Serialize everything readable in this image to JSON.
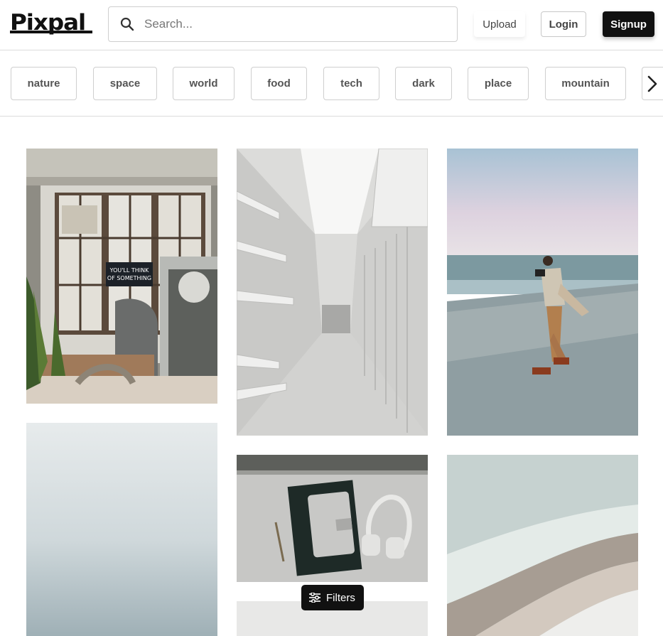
{
  "brand": {
    "logo_text": "Pixpal"
  },
  "search": {
    "placeholder": "Search...",
    "value": "",
    "icon": "search-icon"
  },
  "nav": {
    "upload_label": "Upload",
    "login_label": "Login",
    "signup_label": "Signup"
  },
  "categories": {
    "items": [
      "nature",
      "space",
      "world",
      "food",
      "tech",
      "dark",
      "place",
      "mountain"
    ],
    "next_icon": "chevron-right-icon"
  },
  "photos": [
    {
      "subject": "office-window"
    },
    {
      "subject": "white-corridor"
    },
    {
      "subject": "beach-photographer"
    },
    {
      "subject": "foggy-sea"
    },
    {
      "subject": "notebook-headphones"
    },
    {
      "subject": "abstract-waves"
    },
    {
      "subject": "partial-photo"
    }
  ],
  "filters": {
    "label": "Filters",
    "icon": "sliders-icon"
  },
  "colors": {
    "brand": "#111111",
    "border": "#cfcfcf",
    "text": "#555555"
  }
}
